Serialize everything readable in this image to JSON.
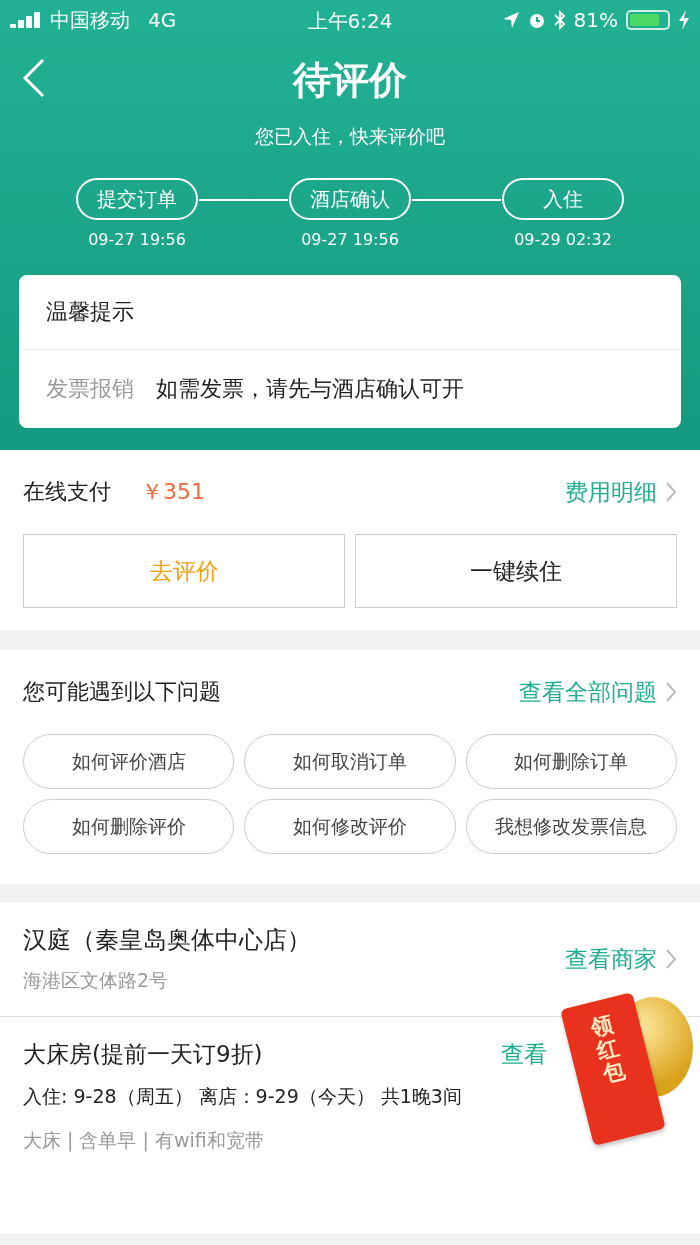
{
  "status_bar": {
    "carrier": "中国移动",
    "network": "4G",
    "time": "上午6:24",
    "battery": "81%"
  },
  "header": {
    "title": "待评价",
    "subtitle": "您已入住，快来评价吧",
    "steps": [
      {
        "label": "提交订单",
        "time": "09-27 19:56"
      },
      {
        "label": "酒店确认",
        "time": "09-27 19:56"
      },
      {
        "label": "入住",
        "time": "09-29 02:32"
      }
    ]
  },
  "notice": {
    "title": "温馨提示",
    "rows": [
      {
        "label": "发票报销",
        "value": "如需发票，请先与酒店确认可开"
      }
    ]
  },
  "payment": {
    "label": "在线支付",
    "amount": "￥351",
    "detail_link": "费用明细",
    "buttons": [
      {
        "label": "去评价",
        "kind": "accent"
      },
      {
        "label": "一键续住",
        "kind": "plain"
      }
    ]
  },
  "faq": {
    "title": "您可能遇到以下问题",
    "link": "查看全部问题",
    "chips": [
      "如何评价酒店",
      "如何取消订单",
      "如何删除订单",
      "如何删除评价",
      "如何修改评价",
      "我想修改发票信息"
    ]
  },
  "hotel": {
    "name": "汉庭（秦皇岛奥体中心店）",
    "address": "海港区文体路2号",
    "link": "查看商家"
  },
  "room": {
    "name": "大床房(提前一天订9折)",
    "link": "查看",
    "dates": "入住: 9-28（周五） 离店：9-29（今天） 共1晚3间",
    "features": "大床 | 含单早 | 有wifi和宽带"
  },
  "red_packet": {
    "label": "领红包"
  }
}
